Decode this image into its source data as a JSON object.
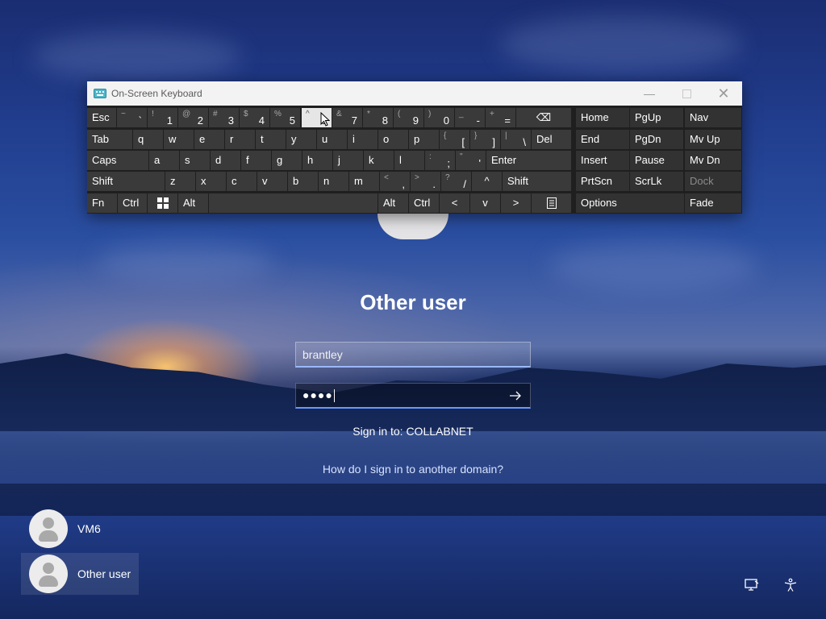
{
  "osk": {
    "title": "On-Screen Keyboard",
    "rows": [
      [
        {
          "label": "Esc"
        },
        {
          "shift": "~",
          "main": "`"
        },
        {
          "shift": "!",
          "main": "1"
        },
        {
          "shift": "@",
          "main": "2"
        },
        {
          "shift": "#",
          "main": "3"
        },
        {
          "shift": "$",
          "main": "4"
        },
        {
          "shift": "%",
          "main": "5"
        },
        {
          "shift": "^",
          "main": "6"
        },
        {
          "shift": "&",
          "main": "7"
        },
        {
          "shift": "*",
          "main": "8"
        },
        {
          "shift": "(",
          "main": "9"
        },
        {
          "shift": ")",
          "main": "0"
        },
        {
          "shift": "_",
          "main": "-"
        },
        {
          "shift": "+",
          "main": "="
        },
        {
          "label": "⌫"
        },
        {
          "label": "Home"
        },
        {
          "label": "PgUp"
        },
        {
          "label": "Nav"
        }
      ],
      [
        {
          "label": "Tab"
        },
        {
          "label": "q"
        },
        {
          "label": "w"
        },
        {
          "label": "e"
        },
        {
          "label": "r"
        },
        {
          "label": "t"
        },
        {
          "label": "y"
        },
        {
          "label": "u"
        },
        {
          "label": "i"
        },
        {
          "label": "o"
        },
        {
          "label": "p"
        },
        {
          "shift": "{",
          "main": "["
        },
        {
          "shift": "}",
          "main": "]"
        },
        {
          "shift": "|",
          "main": "\\"
        },
        {
          "label": "Del"
        },
        {
          "label": "End"
        },
        {
          "label": "PgDn"
        },
        {
          "label": "Mv Up"
        }
      ],
      [
        {
          "label": "Caps"
        },
        {
          "label": "a"
        },
        {
          "label": "s"
        },
        {
          "label": "d"
        },
        {
          "label": "f"
        },
        {
          "label": "g"
        },
        {
          "label": "h"
        },
        {
          "label": "j"
        },
        {
          "label": "k"
        },
        {
          "label": "l"
        },
        {
          "shift": ":",
          "main": ";"
        },
        {
          "shift": "\"",
          "main": "'"
        },
        {
          "label": "Enter"
        },
        {
          "label": "Insert"
        },
        {
          "label": "Pause"
        },
        {
          "label": "Mv Dn"
        }
      ],
      [
        {
          "label": "Shift"
        },
        {
          "label": "z"
        },
        {
          "label": "x"
        },
        {
          "label": "c"
        },
        {
          "label": "v"
        },
        {
          "label": "b"
        },
        {
          "label": "n"
        },
        {
          "label": "m"
        },
        {
          "shift": "<",
          "main": ","
        },
        {
          "shift": ">",
          "main": "."
        },
        {
          "shift": "?",
          "main": "/"
        },
        {
          "label": "^"
        },
        {
          "label": "Shift"
        },
        {
          "label": "PrtScn"
        },
        {
          "label": "ScrLk"
        },
        {
          "label": "Dock"
        }
      ],
      [
        {
          "label": "Fn"
        },
        {
          "label": "Ctrl"
        },
        {
          "label": "windows-icon",
          "icon": "win"
        },
        {
          "label": "Alt"
        },
        {
          "label": ""
        },
        {
          "label": "Alt"
        },
        {
          "label": "Ctrl"
        },
        {
          "label": "<"
        },
        {
          "label": "v"
        },
        {
          "label": ">"
        },
        {
          "label": "menu-icon",
          "icon": "menu"
        },
        {
          "label": "Options"
        },
        {
          "label": "Fade"
        }
      ]
    ]
  },
  "login": {
    "display_name": "Other user",
    "username_value": "brantley",
    "password_dots": "●●●●",
    "sign_in_to": "Sign in to: COLLABNET",
    "other_domain_link": "How do I sign in to another domain?"
  },
  "accounts": [
    {
      "name": "VM6",
      "selected": false
    },
    {
      "name": "Other user",
      "selected": true
    }
  ],
  "tray": {
    "network_icon": "network-icon",
    "accessibility_icon": "accessibility-icon"
  }
}
